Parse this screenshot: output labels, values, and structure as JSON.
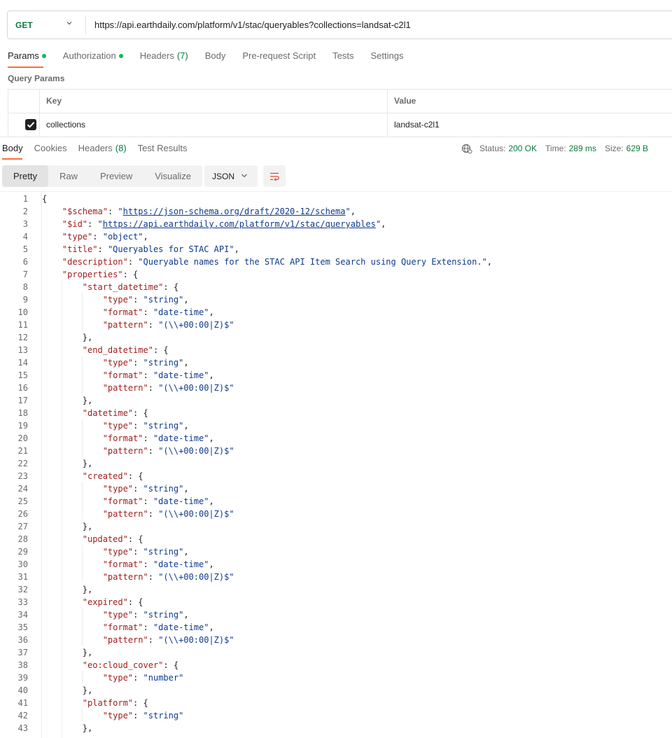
{
  "request": {
    "method": "GET",
    "url": "https://api.earthdaily.com/platform/v1/stac/queryables?collections=landsat-c2l1"
  },
  "request_tabs": [
    {
      "label": "Params",
      "dot": true
    },
    {
      "label": "Authorization",
      "dot": true
    },
    {
      "label": "Headers",
      "count": "(7)"
    },
    {
      "label": "Body"
    },
    {
      "label": "Pre-request Script"
    },
    {
      "label": "Tests"
    },
    {
      "label": "Settings"
    }
  ],
  "query_params": {
    "title": "Query Params",
    "col_key": "Key",
    "col_value": "Value",
    "rows": [
      {
        "key": "collections",
        "value": "landsat-c2l1",
        "checked": true
      }
    ]
  },
  "response_tabs": [
    {
      "label": "Body"
    },
    {
      "label": "Cookies"
    },
    {
      "label": "Headers",
      "count": "(8)"
    },
    {
      "label": "Test Results"
    }
  ],
  "status": {
    "status_label": "Status:",
    "status_value": "200 OK",
    "time_label": "Time:",
    "time_value": "289 ms",
    "size_label": "Size:",
    "size_value": "629 B"
  },
  "view_tabs": [
    "Pretty",
    "Raw",
    "Preview",
    "Visualize"
  ],
  "format": "JSON",
  "code_lines": [
    "{",
    "    \"$schema\": \"https://json-schema.org/draft/2020-12/schema\",",
    "    \"$id\": \"https://api.earthdaily.com/platform/v1/stac/queryables\",",
    "    \"type\": \"object\",",
    "    \"title\": \"Queryables for STAC API\",",
    "    \"description\": \"Queryable names for the STAC API Item Search using Query Extension.\",",
    "    \"properties\": {",
    "        \"start_datetime\": {",
    "            \"type\": \"string\",",
    "            \"format\": \"date-time\",",
    "            \"pattern\": \"(\\\\+00:00|Z)$\"",
    "        },",
    "        \"end_datetime\": {",
    "            \"type\": \"string\",",
    "            \"format\": \"date-time\",",
    "            \"pattern\": \"(\\\\+00:00|Z)$\"",
    "        },",
    "        \"datetime\": {",
    "            \"type\": \"string\",",
    "            \"format\": \"date-time\",",
    "            \"pattern\": \"(\\\\+00:00|Z)$\"",
    "        },",
    "        \"created\": {",
    "            \"type\": \"string\",",
    "            \"format\": \"date-time\",",
    "            \"pattern\": \"(\\\\+00:00|Z)$\"",
    "        },",
    "        \"updated\": {",
    "            \"type\": \"string\",",
    "            \"format\": \"date-time\",",
    "            \"pattern\": \"(\\\\+00:00|Z)$\"",
    "        },",
    "        \"expired\": {",
    "            \"type\": \"string\",",
    "            \"format\": \"date-time\",",
    "            \"pattern\": \"(\\\\+00:00|Z)$\"",
    "        },",
    "        \"eo:cloud_cover\": {",
    "            \"type\": \"number\"",
    "        },",
    "        \"platform\": {",
    "            \"type\": \"string\"",
    "        },"
  ],
  "colors": {
    "accent": "#ff6c37",
    "success": "#0b7a3e",
    "key": "#a01d1d",
    "string": "#0e3a8c"
  }
}
